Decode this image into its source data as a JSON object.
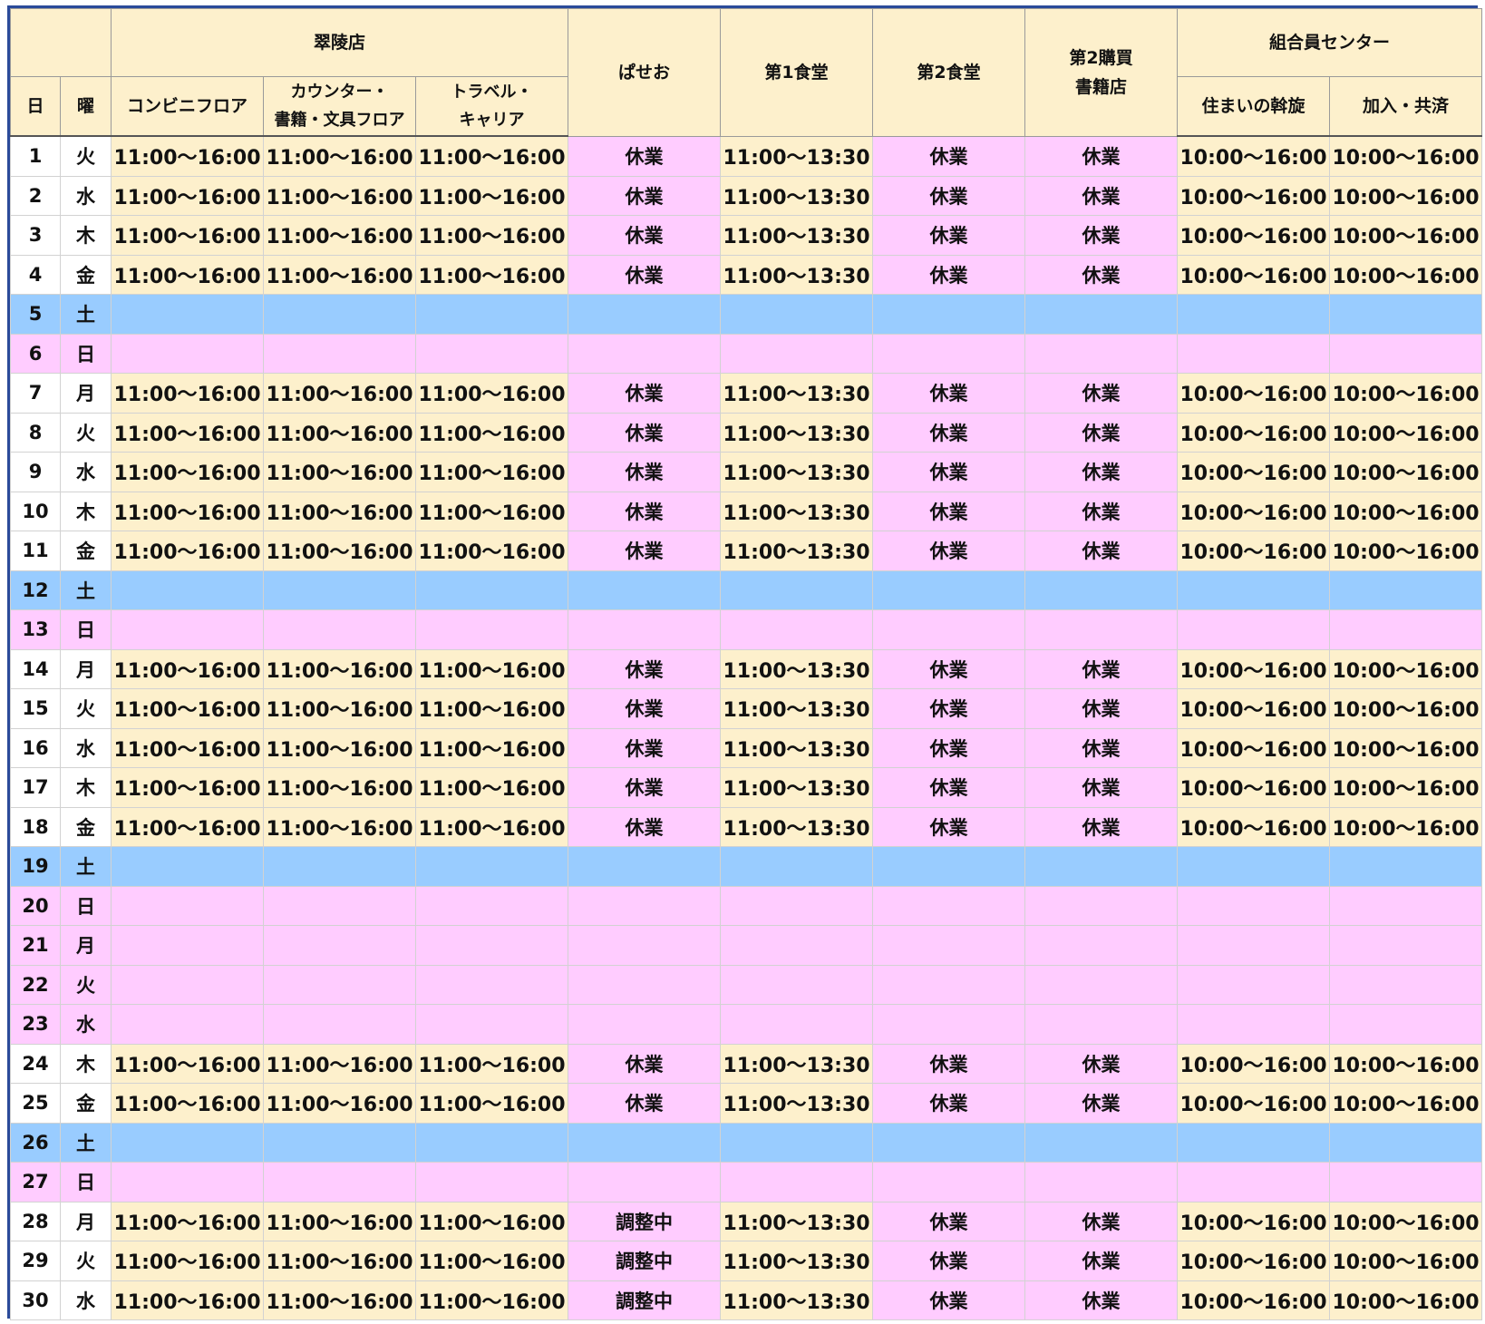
{
  "header": {
    "day": "日",
    "dow": "曜",
    "suiryo": "翠陵店",
    "conveni": "コンビニフロア",
    "counter_line1": "カウンター・",
    "counter_line2": "書籍・文具フロア",
    "travel_line1": "トラベル・",
    "travel_line2": "キャリア",
    "paseo": "ぱせお",
    "shokudo1": "第1食堂",
    "shokudo2": "第2食堂",
    "kobai2_line1": "第2購買",
    "kobai2_line2": "書籍店",
    "center": "組合員センター",
    "sumai": "住まいの斡旋",
    "kanyu": "加入・共済"
  },
  "rows": [
    {
      "day": "1",
      "dow": "火",
      "type": "open",
      "cells": [
        "11:00～16:00",
        "11:00～16:00",
        "11:00～16:00",
        "休業",
        "11:00～13:30",
        "休業",
        "休業",
        "10:00～16:00",
        "10:00～16:00"
      ]
    },
    {
      "day": "2",
      "dow": "水",
      "type": "open",
      "cells": [
        "11:00～16:00",
        "11:00～16:00",
        "11:00～16:00",
        "休業",
        "11:00～13:30",
        "休業",
        "休業",
        "10:00～16:00",
        "10:00～16:00"
      ]
    },
    {
      "day": "3",
      "dow": "木",
      "type": "open",
      "cells": [
        "11:00～16:00",
        "11:00～16:00",
        "11:00～16:00",
        "休業",
        "11:00～13:30",
        "休業",
        "休業",
        "10:00～16:00",
        "10:00～16:00"
      ]
    },
    {
      "day": "4",
      "dow": "金",
      "type": "open",
      "cells": [
        "11:00～16:00",
        "11:00～16:00",
        "11:00～16:00",
        "休業",
        "11:00～13:30",
        "休業",
        "休業",
        "10:00～16:00",
        "10:00～16:00"
      ]
    },
    {
      "day": "5",
      "dow": "土",
      "type": "sat",
      "cells": [
        "",
        "",
        "",
        "",
        "",
        "",
        "",
        "",
        ""
      ]
    },
    {
      "day": "6",
      "dow": "日",
      "type": "hol",
      "cells": [
        "",
        "",
        "",
        "",
        "",
        "",
        "",
        "",
        ""
      ]
    },
    {
      "day": "7",
      "dow": "月",
      "type": "open",
      "cells": [
        "11:00～16:00",
        "11:00～16:00",
        "11:00～16:00",
        "休業",
        "11:00～13:30",
        "休業",
        "休業",
        "10:00～16:00",
        "10:00～16:00"
      ]
    },
    {
      "day": "8",
      "dow": "火",
      "type": "open",
      "cells": [
        "11:00～16:00",
        "11:00～16:00",
        "11:00～16:00",
        "休業",
        "11:00～13:30",
        "休業",
        "休業",
        "10:00～16:00",
        "10:00～16:00"
      ]
    },
    {
      "day": "9",
      "dow": "水",
      "type": "open",
      "cells": [
        "11:00～16:00",
        "11:00～16:00",
        "11:00～16:00",
        "休業",
        "11:00～13:30",
        "休業",
        "休業",
        "10:00～16:00",
        "10:00～16:00"
      ]
    },
    {
      "day": "10",
      "dow": "木",
      "type": "open",
      "cells": [
        "11:00～16:00",
        "11:00～16:00",
        "11:00～16:00",
        "休業",
        "11:00～13:30",
        "休業",
        "休業",
        "10:00～16:00",
        "10:00～16:00"
      ]
    },
    {
      "day": "11",
      "dow": "金",
      "type": "open",
      "cells": [
        "11:00～16:00",
        "11:00～16:00",
        "11:00～16:00",
        "休業",
        "11:00～13:30",
        "休業",
        "休業",
        "10:00～16:00",
        "10:00～16:00"
      ]
    },
    {
      "day": "12",
      "dow": "土",
      "type": "sat",
      "cells": [
        "",
        "",
        "",
        "",
        "",
        "",
        "",
        "",
        ""
      ]
    },
    {
      "day": "13",
      "dow": "日",
      "type": "hol",
      "cells": [
        "",
        "",
        "",
        "",
        "",
        "",
        "",
        "",
        ""
      ]
    },
    {
      "day": "14",
      "dow": "月",
      "type": "open",
      "cells": [
        "11:00～16:00",
        "11:00～16:00",
        "11:00～16:00",
        "休業",
        "11:00～13:30",
        "休業",
        "休業",
        "10:00～16:00",
        "10:00～16:00"
      ]
    },
    {
      "day": "15",
      "dow": "火",
      "type": "open",
      "cells": [
        "11:00～16:00",
        "11:00～16:00",
        "11:00～16:00",
        "休業",
        "11:00～13:30",
        "休業",
        "休業",
        "10:00～16:00",
        "10:00～16:00"
      ]
    },
    {
      "day": "16",
      "dow": "水",
      "type": "open",
      "cells": [
        "11:00～16:00",
        "11:00～16:00",
        "11:00～16:00",
        "休業",
        "11:00～13:30",
        "休業",
        "休業",
        "10:00～16:00",
        "10:00～16:00"
      ]
    },
    {
      "day": "17",
      "dow": "木",
      "type": "open",
      "cells": [
        "11:00～16:00",
        "11:00～16:00",
        "11:00～16:00",
        "休業",
        "11:00～13:30",
        "休業",
        "休業",
        "10:00～16:00",
        "10:00～16:00"
      ]
    },
    {
      "day": "18",
      "dow": "金",
      "type": "open",
      "cells": [
        "11:00～16:00",
        "11:00～16:00",
        "11:00～16:00",
        "休業",
        "11:00～13:30",
        "休業",
        "休業",
        "10:00～16:00",
        "10:00～16:00"
      ]
    },
    {
      "day": "19",
      "dow": "土",
      "type": "sat",
      "cells": [
        "",
        "",
        "",
        "",
        "",
        "",
        "",
        "",
        ""
      ]
    },
    {
      "day": "20",
      "dow": "日",
      "type": "hol",
      "cells": [
        "",
        "",
        "",
        "",
        "",
        "",
        "",
        "",
        ""
      ]
    },
    {
      "day": "21",
      "dow": "月",
      "type": "hol",
      "cells": [
        "",
        "",
        "",
        "",
        "",
        "",
        "",
        "",
        ""
      ]
    },
    {
      "day": "22",
      "dow": "火",
      "type": "hol",
      "cells": [
        "",
        "",
        "",
        "",
        "",
        "",
        "",
        "",
        ""
      ]
    },
    {
      "day": "23",
      "dow": "水",
      "type": "hol",
      "cells": [
        "",
        "",
        "",
        "",
        "",
        "",
        "",
        "",
        ""
      ]
    },
    {
      "day": "24",
      "dow": "木",
      "type": "open",
      "cells": [
        "11:00～16:00",
        "11:00～16:00",
        "11:00～16:00",
        "休業",
        "11:00～13:30",
        "休業",
        "休業",
        "10:00～16:00",
        "10:00～16:00"
      ]
    },
    {
      "day": "25",
      "dow": "金",
      "type": "open",
      "cells": [
        "11:00～16:00",
        "11:00～16:00",
        "11:00～16:00",
        "休業",
        "11:00～13:30",
        "休業",
        "休業",
        "10:00～16:00",
        "10:00～16:00"
      ]
    },
    {
      "day": "26",
      "dow": "土",
      "type": "sat",
      "cells": [
        "",
        "",
        "",
        "",
        "",
        "",
        "",
        "",
        ""
      ]
    },
    {
      "day": "27",
      "dow": "日",
      "type": "hol",
      "cells": [
        "",
        "",
        "",
        "",
        "",
        "",
        "",
        "",
        ""
      ]
    },
    {
      "day": "28",
      "dow": "月",
      "type": "open",
      "cells": [
        "11:00～16:00",
        "11:00～16:00",
        "11:00～16:00",
        "調整中",
        "11:00～13:30",
        "休業",
        "休業",
        "10:00～16:00",
        "10:00～16:00"
      ]
    },
    {
      "day": "29",
      "dow": "火",
      "type": "open",
      "cells": [
        "11:00～16:00",
        "11:00～16:00",
        "11:00～16:00",
        "調整中",
        "11:00～13:30",
        "休業",
        "休業",
        "10:00～16:00",
        "10:00～16:00"
      ]
    },
    {
      "day": "30",
      "dow": "水",
      "type": "open",
      "cells": [
        "11:00～16:00",
        "11:00～16:00",
        "11:00～16:00",
        "調整中",
        "11:00～13:30",
        "休業",
        "休業",
        "10:00～16:00",
        "10:00～16:00"
      ]
    }
  ],
  "colors": {
    "open": "#fdf0cc",
    "closed": "#ffccff",
    "saturday": "#99ccff",
    "holiday": "#ffccff",
    "frame": "#2a4a9a"
  }
}
